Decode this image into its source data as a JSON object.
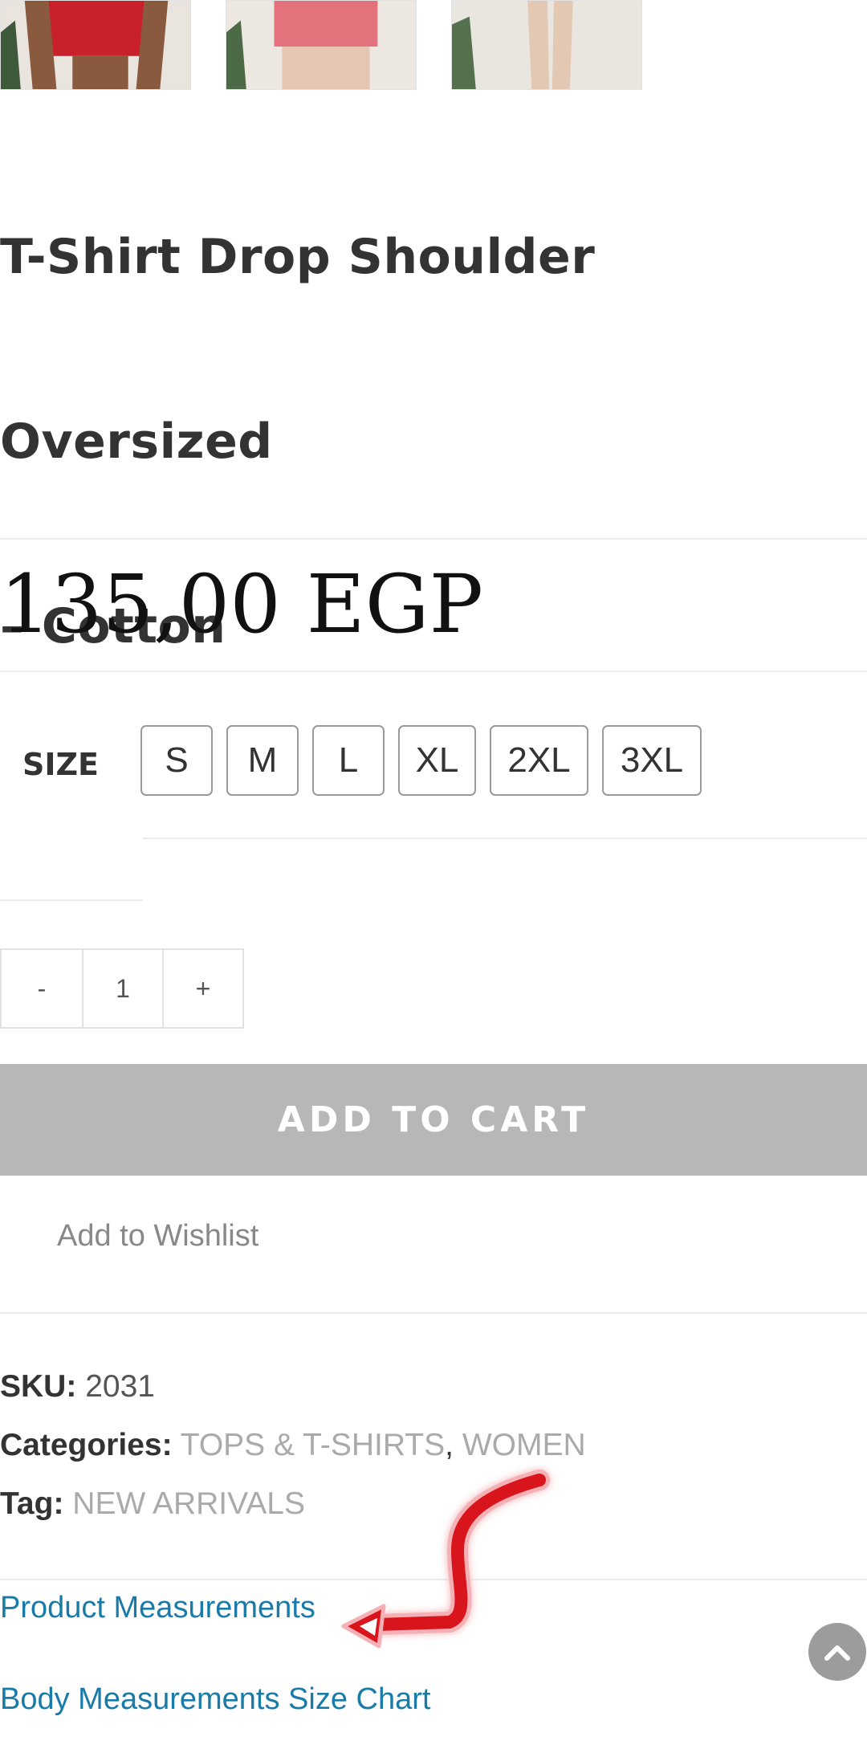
{
  "gallery": {
    "thumbnails": [
      {
        "alt": "red-tshirt-thumbnail",
        "color": "#c8212b"
      },
      {
        "alt": "pink-tshirt-thumbnail",
        "color": "#e4727c"
      },
      {
        "alt": "white-tshirt-thumbnail",
        "color": "#e9e5df"
      }
    ]
  },
  "product": {
    "title_line1": "T-Shirt Drop Shoulder Oversized",
    "title_line2": "– Cotton",
    "price": "135,00 EGP"
  },
  "variations": {
    "size_label": "SIZE",
    "sizes": [
      "S",
      "M",
      "L",
      "XL",
      "2XL",
      "3XL"
    ]
  },
  "quantity": {
    "minus": "-",
    "value": "1",
    "plus": "+"
  },
  "actions": {
    "add_to_cart": "ADD TO CART",
    "wishlist": "Add to Wishlist"
  },
  "meta": {
    "sku_label": "SKU:",
    "sku_value": "2031",
    "categories_label": "Categories:",
    "categories": [
      "TOPS & T-SHIRTS",
      "WOMEN"
    ],
    "category_separator": ",",
    "tag_label": "Tag:",
    "tag_value": "NEW ARRIVALS"
  },
  "links": {
    "product_measurements": "Product Measurements",
    "body_measurements": "Body Measurements Size Chart"
  },
  "colors": {
    "link": "#1a7ba8",
    "cart_button": "#b7b7b7",
    "annotation_arrow": "#d8141c"
  },
  "icons": {
    "scroll_top": "chevron-up-icon"
  }
}
